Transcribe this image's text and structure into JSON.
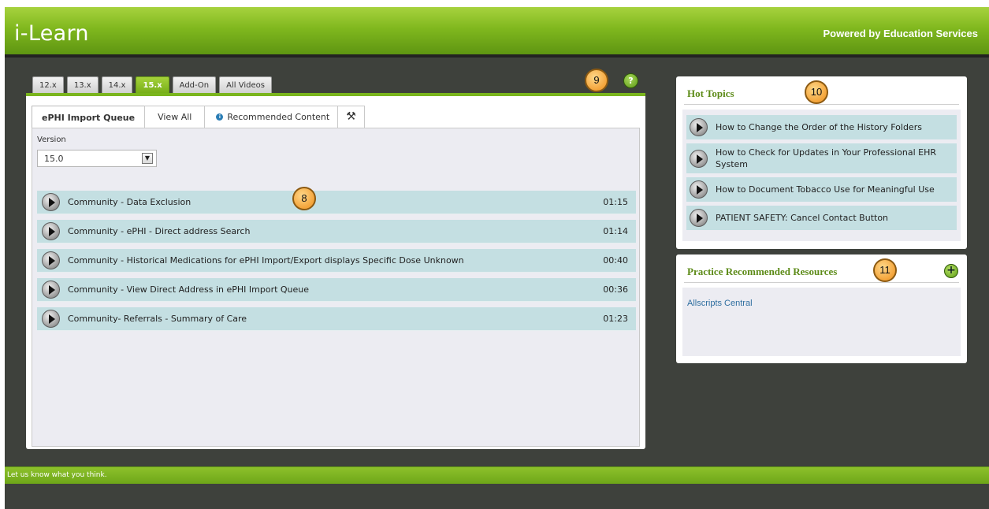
{
  "header": {
    "title": "i-Learn",
    "powered_by": "Powered by Education Services"
  },
  "version_tabs": [
    {
      "label": "12.x",
      "active": false
    },
    {
      "label": "13.x",
      "active": false
    },
    {
      "label": "14.x",
      "active": false
    },
    {
      "label": "15.x",
      "active": true
    },
    {
      "label": "Add-On",
      "active": false
    },
    {
      "label": "All Videos",
      "active": false
    }
  ],
  "content_tabs": {
    "import_queue": "ePHI Import Queue",
    "view_all": "View All",
    "recommended": "Recommended Content",
    "tools_icon": "tools-icon"
  },
  "version_filter": {
    "label": "Version",
    "selected": "15.0"
  },
  "videos": [
    {
      "title": "Community - Data Exclusion",
      "duration": "01:15"
    },
    {
      "title": "Community - ePHI - Direct address Search",
      "duration": "01:14"
    },
    {
      "title": "Community - Historical Medications for ePHI Import/Export displays Specific Dose Unknown",
      "duration": "00:40"
    },
    {
      "title": "Community - View Direct Address in ePHI Import Queue",
      "duration": "00:36"
    },
    {
      "title": "Community- Referrals - Summary of Care",
      "duration": "01:23"
    }
  ],
  "hot_topics": {
    "title": "Hot Topics",
    "items": [
      "How to Change the Order of the History Folders",
      "How to Check for Updates in Your Professional EHR System",
      "How to Document Tobacco Use for Meaningful Use",
      "PATIENT SAFETY: Cancel Contact Button"
    ]
  },
  "resources": {
    "title": "Practice Recommended Resources",
    "link": "Allscripts Central",
    "add_symbol": "+"
  },
  "help_symbol": "?",
  "callouts": [
    "8",
    "9",
    "10",
    "11"
  ],
  "footer": {
    "feedback": "Let us know what you think."
  },
  "colors": {
    "brand_green": "#7ab51d",
    "row_teal": "#c4dfe2",
    "background_dark": "#3e413c",
    "callout_orange": "#f4a43a"
  }
}
